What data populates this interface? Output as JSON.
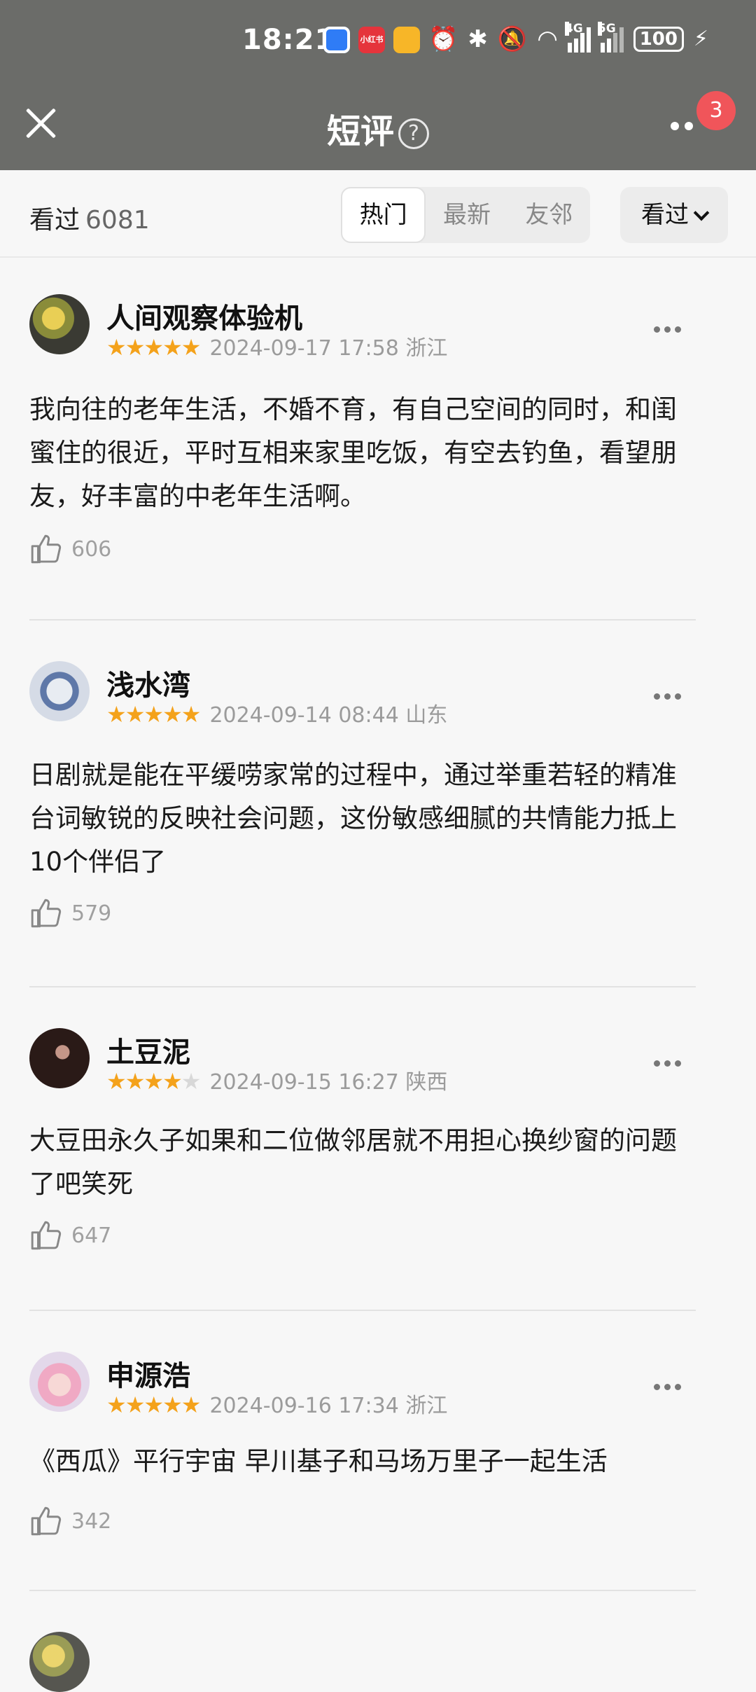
{
  "status": {
    "time": "18:21",
    "app_icon_label": "小红书",
    "network_4g": "4G",
    "network_5g": "5G",
    "battery": "100"
  },
  "nav": {
    "title": "短评",
    "help": "?",
    "badge": "3"
  },
  "filter": {
    "seen_label": "看过",
    "seen_count": "6081",
    "tabs": [
      "热门",
      "最新",
      "友邻"
    ],
    "dropdown": "看过"
  },
  "reviews": [
    {
      "name": "人间观察体验机",
      "rating": 5,
      "date": "2024-09-17 17:58",
      "location": "浙江",
      "text": "我向往的老年生活，不婚不育，有自己空间的同时，和闺蜜住的很近，平时互相来家里吃饭，有空去钓鱼，看望朋友，好丰富的中老年生活啊。",
      "likes": "606"
    },
    {
      "name": "浅水湾",
      "rating": 5,
      "date": "2024-09-14 08:44",
      "location": "山东",
      "text": "日剧就是能在平缓唠家常的过程中，通过举重若轻的精准台词敏锐的反映社会问题，这份敏感细腻的共情能力抵上10个伴侣了",
      "likes": "579"
    },
    {
      "name": "土豆泥",
      "rating": 4,
      "date": "2024-09-15 16:27",
      "location": "陕西",
      "text": "大豆田永久子如果和二位做邻居就不用担心换纱窗的问题了吧笑死",
      "likes": "647"
    },
    {
      "name": "申源浩",
      "rating": 5,
      "date": "2024-09-16 17:34",
      "location": "浙江",
      "text": "《西瓜》平行宇宙 早川基子和马场万里子一起生活",
      "likes": "342"
    }
  ]
}
